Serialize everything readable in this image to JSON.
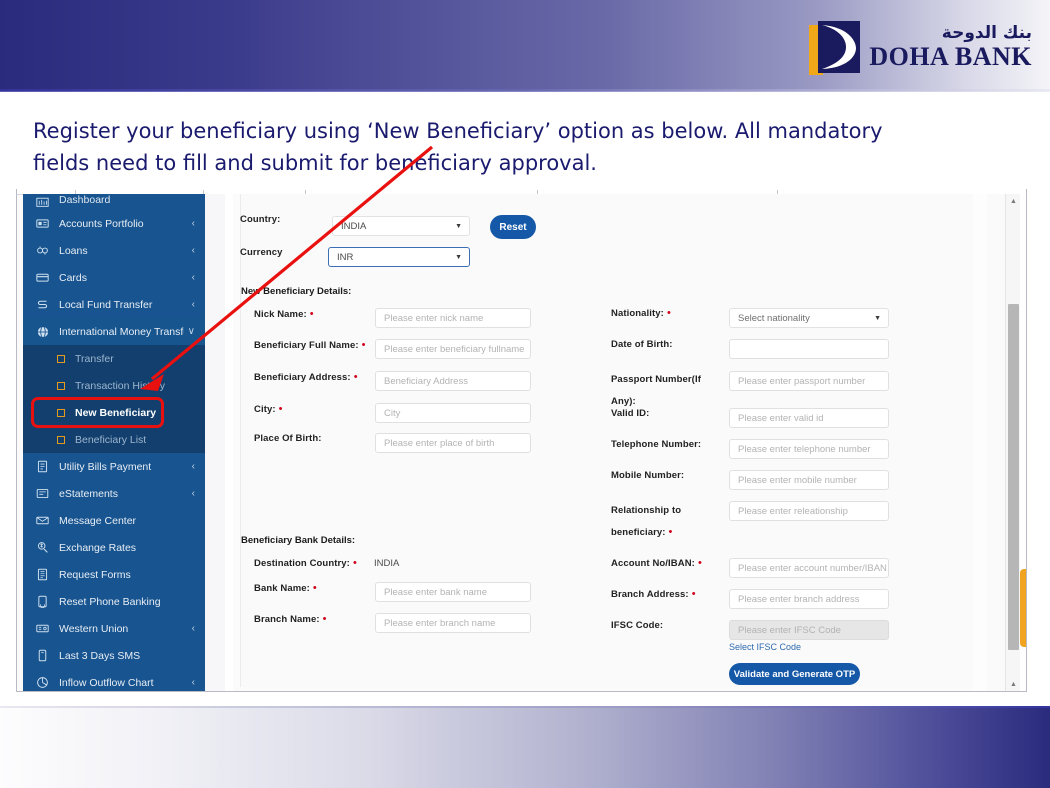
{
  "header": {
    "logo": {
      "arabic": "بنك الدوحة",
      "english": "DOHA BANK"
    }
  },
  "caption": {
    "text": "Register your beneficiary using ‘New Beneficiary’ option as below. All mandatory fields need to fill      and submit for beneficiary approval."
  },
  "sidebar": {
    "items": [
      {
        "label": "Dashboard",
        "icon": "dashboard-icon",
        "caret": ""
      },
      {
        "label": "Accounts Portfolio",
        "icon": "accounts-icon",
        "caret": "‹"
      },
      {
        "label": "Loans",
        "icon": "loans-icon",
        "caret": "‹"
      },
      {
        "label": "Cards",
        "icon": "cards-icon",
        "caret": "‹"
      },
      {
        "label": "Local Fund Transfer",
        "icon": "transfer-icon",
        "caret": "‹"
      },
      {
        "label": "International Money Transfer",
        "icon": "globe-icon",
        "caret": "∨"
      }
    ],
    "subitems": [
      {
        "label": "Transfer",
        "active": false
      },
      {
        "label": "Transaction History",
        "active": false
      },
      {
        "label": "New Beneficiary",
        "active": true
      },
      {
        "label": "Beneficiary List",
        "active": false
      }
    ],
    "items_after": [
      {
        "label": "Utility Bills Payment",
        "icon": "bill-icon",
        "caret": "‹"
      },
      {
        "label": "eStatements",
        "icon": "statement-icon",
        "caret": "‹"
      },
      {
        "label": "Message Center",
        "icon": "mail-icon",
        "caret": ""
      },
      {
        "label": "Exchange Rates",
        "icon": "exchange-icon",
        "caret": ""
      },
      {
        "label": "Request Forms",
        "icon": "forms-icon",
        "caret": ""
      },
      {
        "label": "Reset Phone Banking",
        "icon": "phone-reset-icon",
        "caret": ""
      },
      {
        "label": "Western Union",
        "icon": "western-union-icon",
        "caret": "‹"
      },
      {
        "label": "Last 3 Days SMS",
        "icon": "sms-icon",
        "caret": ""
      },
      {
        "label": "Inflow Outflow Chart",
        "icon": "chart-icon",
        "caret": "‹"
      }
    ]
  },
  "form": {
    "country_label": "Country:",
    "country_value": "INDIA",
    "currency_label": "Currency",
    "currency_value": "INR",
    "reset_button": "Reset",
    "section_beneficiary": "New Beneficiary Details:",
    "section_bank": "Beneficiary Bank Details:",
    "left_fields": [
      {
        "label": "Nick Name:",
        "required": true,
        "placeholder": "Please enter nick name"
      },
      {
        "label": "Beneficiary Full Name:",
        "required": true,
        "placeholder": "Please enter beneficiary fullname"
      },
      {
        "label": "Beneficiary Address:",
        "required": true,
        "placeholder": "Beneficiary Address"
      },
      {
        "label": "City:",
        "required": true,
        "placeholder": "City"
      },
      {
        "label": "Place Of Birth:",
        "required": false,
        "placeholder": "Please enter place of birth"
      }
    ],
    "right_fields": [
      {
        "label": "Nationality:",
        "required": true,
        "placeholder": "Select nationality",
        "type": "select"
      },
      {
        "label": "Date of Birth:",
        "required": false,
        "placeholder": "",
        "type": "text"
      },
      {
        "label": "Passport Number(If Any):",
        "required": false,
        "placeholder": "Please enter passport number",
        "type": "text"
      },
      {
        "label": "Valid ID:",
        "required": false,
        "placeholder": "Please enter valid id",
        "type": "text"
      },
      {
        "label": "Telephone Number:",
        "required": false,
        "placeholder": "Please enter telephone number",
        "type": "text"
      },
      {
        "label": "Mobile Number:",
        "required": false,
        "placeholder": "Please enter mobile number",
        "type": "text"
      },
      {
        "label": "Relationship to beneficiary:",
        "required": true,
        "placeholder": "Please enter releationship",
        "type": "text"
      }
    ],
    "bank_left_fields": [
      {
        "label": "Destination Country:",
        "required": true,
        "value": "INDIA",
        "type": "plain"
      },
      {
        "label": "Bank Name:",
        "required": true,
        "placeholder": "Please enter bank name",
        "type": "text"
      },
      {
        "label": "Branch Name:",
        "required": true,
        "placeholder": "Please enter branch name",
        "type": "text"
      }
    ],
    "bank_right_fields": [
      {
        "label": "Account No/IBAN:",
        "required": true,
        "placeholder": "Please enter account number/IBAN",
        "type": "text"
      },
      {
        "label": "Branch Address:",
        "required": true,
        "placeholder": "Please enter branch address",
        "type": "text"
      },
      {
        "label": "IFSC Code:",
        "required": false,
        "placeholder": "Please enter IFSC Code",
        "type": "disabled"
      }
    ],
    "ifsc_link": "Select IFSC Code",
    "otp_button": "Validate and Generate OTP"
  },
  "colors": {
    "brand_navy": "#1a1a5e",
    "brand_gold": "#f0a818",
    "sidebar_blue": "#18548f",
    "sidebar_sub_blue": "#123f6d",
    "accent_button": "#1658a8",
    "annotation_red": "#e8110f",
    "required_red": "#d0021b",
    "collapse_tab_orange": "#f0a420"
  }
}
